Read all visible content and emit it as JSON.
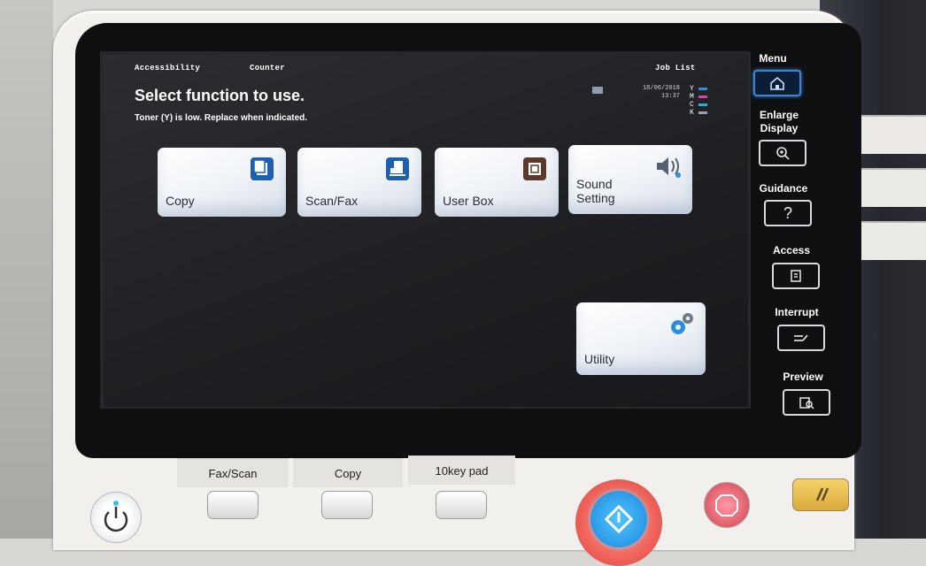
{
  "header": {
    "accessibility": "Accessibility",
    "counter": "Counter",
    "job_list": "Job List",
    "headline": "Select function to use.",
    "message": "Toner (Y) is low. Replace when indicated."
  },
  "status": {
    "date": "18/06/2018",
    "time": "13:37",
    "toner": [
      {
        "letter": "Y",
        "color": "#2e8fe0"
      },
      {
        "letter": "M",
        "color": "#d04aa8"
      },
      {
        "letter": "C",
        "color": "#1bb7d6"
      },
      {
        "letter": "K",
        "color": "#9aa3ad"
      }
    ]
  },
  "tiles": [
    {
      "label": "Copy",
      "icon": "copy-icon"
    },
    {
      "label": "Scan/Fax",
      "icon": "scan-fax-icon"
    },
    {
      "label": "User Box",
      "icon": "user-box-icon"
    },
    {
      "label": "Sound\nSetting",
      "icon": "speaker-icon"
    },
    {
      "label": "Utility",
      "icon": "gears-icon"
    }
  ],
  "hardware": {
    "menu": "Menu",
    "enlarge": "Enlarge\nDisplay",
    "guidance": "Guidance",
    "access": "Access",
    "interrupt": "Interrupt",
    "preview": "Preview",
    "guidance_glyph": "?"
  },
  "keys": {
    "fax_scan": "Fax/Scan",
    "copy": "Copy",
    "tenkey": "10key pad"
  }
}
